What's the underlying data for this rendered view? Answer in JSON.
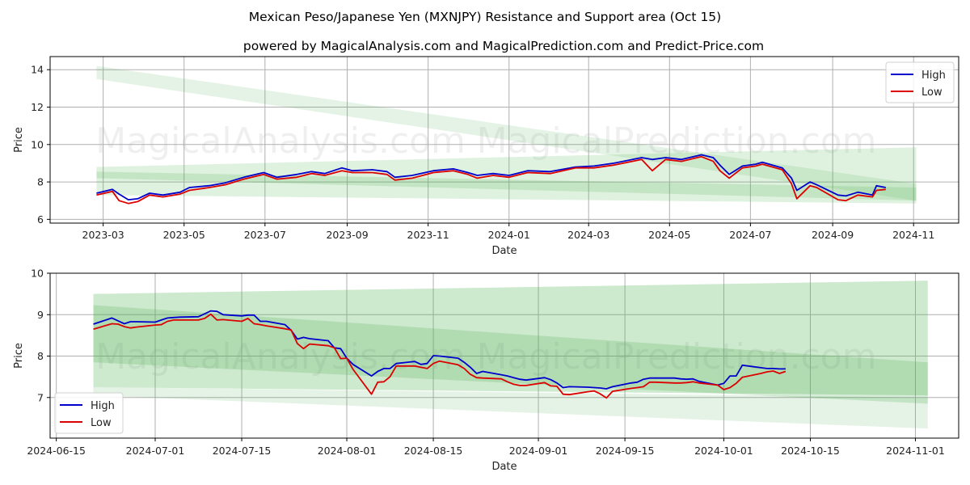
{
  "title": "Mexican Peso/Japanese Yen (MXNJPY) Resistance and Support area (Oct 15)",
  "subtitle": "powered by MagicalAnalysis.com and MagicalPrediction.com and Predict-Price.com",
  "watermarks": [
    "MagicalAnalysis.com",
    "MagicalPrediction.com"
  ],
  "colors": {
    "high": "#0000cc",
    "low": "#dd0000",
    "band": "#4caf50"
  },
  "chart_data": [
    {
      "type": "line",
      "name": "full-history",
      "xlabel": "Date",
      "ylabel": "Price",
      "x_range": [
        "2023-01-20",
        "2024-12-05"
      ],
      "ylim": [
        5.8,
        14.7
      ],
      "grid": true,
      "legend": {
        "position": "top-right",
        "entries": [
          "High",
          "Low"
        ]
      },
      "xticks": [
        "2023-03",
        "2023-05",
        "2023-07",
        "2023-09",
        "2023-11",
        "2024-01",
        "2024-03",
        "2024-05",
        "2024-07",
        "2024-09",
        "2024-11"
      ],
      "yticks": [
        6,
        8,
        10,
        12,
        14
      ],
      "series": [
        {
          "name": "High",
          "x": [
            "2023-02-24",
            "2023-03-08",
            "2023-03-13",
            "2023-03-20",
            "2023-03-27",
            "2023-04-05",
            "2023-04-15",
            "2023-04-28",
            "2023-05-05",
            "2023-05-20",
            "2023-06-01",
            "2023-06-15",
            "2023-06-30",
            "2023-07-10",
            "2023-07-25",
            "2023-08-05",
            "2023-08-15",
            "2023-08-28",
            "2023-09-05",
            "2023-09-20",
            "2023-10-01",
            "2023-10-07",
            "2023-10-20",
            "2023-11-05",
            "2023-11-20",
            "2023-12-01",
            "2023-12-08",
            "2023-12-20",
            "2024-01-01",
            "2024-01-15",
            "2024-02-01",
            "2024-02-20",
            "2024-03-05",
            "2024-03-20",
            "2024-04-10",
            "2024-04-18",
            "2024-04-28",
            "2024-05-10",
            "2024-05-25",
            "2024-06-03",
            "2024-06-08",
            "2024-06-15",
            "2024-06-25",
            "2024-07-05",
            "2024-07-10",
            "2024-07-25",
            "2024-08-01",
            "2024-08-05",
            "2024-08-15",
            "2024-08-20",
            "2024-09-05",
            "2024-09-11",
            "2024-09-20",
            "2024-10-01",
            "2024-10-04",
            "2024-10-11"
          ],
          "values": [
            7.4,
            7.6,
            7.35,
            7.05,
            7.1,
            7.4,
            7.3,
            7.45,
            7.7,
            7.8,
            7.95,
            8.25,
            8.5,
            8.25,
            8.4,
            8.55,
            8.45,
            8.75,
            8.6,
            8.65,
            8.55,
            8.25,
            8.35,
            8.6,
            8.7,
            8.5,
            8.35,
            8.45,
            8.35,
            8.6,
            8.55,
            8.8,
            8.85,
            9.0,
            9.3,
            9.2,
            9.3,
            9.2,
            9.45,
            9.3,
            8.9,
            8.4,
            8.85,
            8.95,
            9.05,
            8.75,
            8.2,
            7.55,
            8.0,
            7.85,
            7.3,
            7.25,
            7.45,
            7.3,
            7.8,
            7.7
          ]
        },
        {
          "name": "Low",
          "x": [
            "2023-02-24",
            "2023-03-08",
            "2023-03-13",
            "2023-03-20",
            "2023-03-27",
            "2023-04-05",
            "2023-04-15",
            "2023-04-28",
            "2023-05-05",
            "2023-05-20",
            "2023-06-01",
            "2023-06-15",
            "2023-06-30",
            "2023-07-10",
            "2023-07-25",
            "2023-08-05",
            "2023-08-15",
            "2023-08-28",
            "2023-09-05",
            "2023-09-20",
            "2023-10-01",
            "2023-10-07",
            "2023-10-20",
            "2023-11-05",
            "2023-11-20",
            "2023-12-01",
            "2023-12-08",
            "2023-12-20",
            "2024-01-01",
            "2024-01-15",
            "2024-02-01",
            "2024-02-20",
            "2024-03-05",
            "2024-03-20",
            "2024-04-10",
            "2024-04-18",
            "2024-04-28",
            "2024-05-10",
            "2024-05-25",
            "2024-06-03",
            "2024-06-08",
            "2024-06-15",
            "2024-06-25",
            "2024-07-05",
            "2024-07-10",
            "2024-07-25",
            "2024-08-01",
            "2024-08-05",
            "2024-08-15",
            "2024-08-20",
            "2024-09-05",
            "2024-09-11",
            "2024-09-20",
            "2024-10-01",
            "2024-10-04",
            "2024-10-11"
          ],
          "values": [
            7.3,
            7.5,
            7.0,
            6.85,
            6.95,
            7.3,
            7.2,
            7.35,
            7.55,
            7.7,
            7.85,
            8.15,
            8.4,
            8.15,
            8.25,
            8.45,
            8.35,
            8.6,
            8.5,
            8.5,
            8.4,
            8.1,
            8.2,
            8.5,
            8.6,
            8.4,
            8.2,
            8.35,
            8.25,
            8.5,
            8.45,
            8.75,
            8.75,
            8.9,
            9.2,
            8.6,
            9.2,
            9.1,
            9.35,
            9.1,
            8.6,
            8.2,
            8.75,
            8.85,
            8.95,
            8.65,
            7.9,
            7.1,
            7.8,
            7.7,
            7.05,
            7.0,
            7.3,
            7.2,
            7.55,
            7.6
          ]
        }
      ],
      "bands": [
        {
          "name": "upper-resistance-band",
          "x": [
            "2023-02-24",
            "2024-11-03"
          ],
          "upper": [
            14.2,
            7.9
          ],
          "lower": [
            13.5,
            7.0
          ],
          "opacity": 0.15
        },
        {
          "name": "support-band-wide",
          "x": [
            "2023-02-24",
            "2024-11-03"
          ],
          "upper": [
            8.8,
            9.85
          ],
          "lower": [
            7.3,
            6.85
          ],
          "opacity": 0.18
        },
        {
          "name": "support-band-inner",
          "x": [
            "2023-02-24",
            "2024-11-03"
          ],
          "upper": [
            8.55,
            7.7
          ],
          "lower": [
            8.2,
            7.0
          ],
          "opacity": 0.18
        }
      ]
    },
    {
      "type": "line",
      "name": "recent-zoom",
      "xlabel": "Date",
      "ylabel": "Price",
      "x_range": [
        "2024-06-14",
        "2024-11-08"
      ],
      "ylim": [
        6.02,
        10.0
      ],
      "grid": true,
      "legend": {
        "position": "lower-left",
        "entries": [
          "High",
          "Low"
        ]
      },
      "xticks": [
        "2024-06-15",
        "2024-07-01",
        "2024-07-15",
        "2024-08-01",
        "2024-08-15",
        "2024-09-01",
        "2024-09-15",
        "2024-10-01",
        "2024-10-15",
        "2024-11-01"
      ],
      "yticks": [
        7,
        8,
        9,
        10
      ],
      "series": [
        {
          "name": "High",
          "x": [
            "2024-06-21",
            "2024-06-24",
            "2024-06-25",
            "2024-06-26",
            "2024-06-27",
            "2024-06-28",
            "2024-07-01",
            "2024-07-02",
            "2024-07-03",
            "2024-07-04",
            "2024-07-05",
            "2024-07-08",
            "2024-07-09",
            "2024-07-10",
            "2024-07-11",
            "2024-07-12",
            "2024-07-15",
            "2024-07-16",
            "2024-07-17",
            "2024-07-18",
            "2024-07-19",
            "2024-07-22",
            "2024-07-23",
            "2024-07-24",
            "2024-07-25",
            "2024-07-26",
            "2024-07-29",
            "2024-07-30",
            "2024-07-31",
            "2024-08-01",
            "2024-08-02",
            "2024-08-05",
            "2024-08-06",
            "2024-08-07",
            "2024-08-08",
            "2024-08-09",
            "2024-08-12",
            "2024-08-13",
            "2024-08-14",
            "2024-08-15",
            "2024-08-16",
            "2024-08-19",
            "2024-08-20",
            "2024-08-21",
            "2024-08-22",
            "2024-08-23",
            "2024-08-26",
            "2024-08-27",
            "2024-08-28",
            "2024-08-29",
            "2024-08-30",
            "2024-09-02",
            "2024-09-03",
            "2024-09-04",
            "2024-09-05",
            "2024-09-06",
            "2024-09-09",
            "2024-09-10",
            "2024-09-11",
            "2024-09-12",
            "2024-09-13",
            "2024-09-16",
            "2024-09-17",
            "2024-09-18",
            "2024-09-19",
            "2024-09-20",
            "2024-09-23",
            "2024-09-24",
            "2024-09-25",
            "2024-09-26",
            "2024-09-27",
            "2024-09-30",
            "2024-10-01",
            "2024-10-02",
            "2024-10-03",
            "2024-10-04",
            "2024-10-07",
            "2024-10-08",
            "2024-10-09",
            "2024-10-10",
            "2024-10-11"
          ],
          "values": [
            8.77,
            8.92,
            8.85,
            8.78,
            8.83,
            8.83,
            8.82,
            8.87,
            8.92,
            8.93,
            8.94,
            8.95,
            9.02,
            9.09,
            9.08,
            9.0,
            8.97,
            8.99,
            8.99,
            8.84,
            8.84,
            8.76,
            8.62,
            8.41,
            8.45,
            8.42,
            8.37,
            8.2,
            8.18,
            7.95,
            7.8,
            7.52,
            7.63,
            7.7,
            7.7,
            7.82,
            7.87,
            7.8,
            7.82,
            8.01,
            8.0,
            7.95,
            7.85,
            7.73,
            7.58,
            7.63,
            7.55,
            7.52,
            7.48,
            7.44,
            7.42,
            7.48,
            7.43,
            7.35,
            7.24,
            7.26,
            7.25,
            7.24,
            7.23,
            7.21,
            7.26,
            7.35,
            7.37,
            7.44,
            7.47,
            7.47,
            7.47,
            7.45,
            7.44,
            7.45,
            7.39,
            7.3,
            7.34,
            7.52,
            7.52,
            7.78,
            7.72,
            7.7,
            7.7,
            7.69,
            7.69
          ]
        },
        {
          "name": "Low",
          "x": [
            "2024-06-21",
            "2024-06-24",
            "2024-06-25",
            "2024-06-26",
            "2024-06-27",
            "2024-06-28",
            "2024-07-01",
            "2024-07-02",
            "2024-07-03",
            "2024-07-04",
            "2024-07-05",
            "2024-07-08",
            "2024-07-09",
            "2024-07-10",
            "2024-07-11",
            "2024-07-12",
            "2024-07-15",
            "2024-07-16",
            "2024-07-17",
            "2024-07-18",
            "2024-07-19",
            "2024-07-22",
            "2024-07-23",
            "2024-07-24",
            "2024-07-25",
            "2024-07-26",
            "2024-07-29",
            "2024-07-30",
            "2024-07-31",
            "2024-08-01",
            "2024-08-02",
            "2024-08-05",
            "2024-08-06",
            "2024-08-07",
            "2024-08-08",
            "2024-08-09",
            "2024-08-12",
            "2024-08-13",
            "2024-08-14",
            "2024-08-15",
            "2024-08-16",
            "2024-08-19",
            "2024-08-20",
            "2024-08-21",
            "2024-08-22",
            "2024-08-23",
            "2024-08-26",
            "2024-08-27",
            "2024-08-28",
            "2024-08-29",
            "2024-08-30",
            "2024-09-02",
            "2024-09-03",
            "2024-09-04",
            "2024-09-05",
            "2024-09-06",
            "2024-09-09",
            "2024-09-10",
            "2024-09-11",
            "2024-09-12",
            "2024-09-13",
            "2024-09-16",
            "2024-09-17",
            "2024-09-18",
            "2024-09-19",
            "2024-09-20",
            "2024-09-23",
            "2024-09-24",
            "2024-09-25",
            "2024-09-26",
            "2024-09-27",
            "2024-09-30",
            "2024-10-01",
            "2024-10-02",
            "2024-10-03",
            "2024-10-04",
            "2024-10-07",
            "2024-10-08",
            "2024-10-09",
            "2024-10-10",
            "2024-10-11"
          ],
          "values": [
            8.65,
            8.78,
            8.77,
            8.71,
            8.68,
            8.7,
            8.75,
            8.76,
            8.84,
            8.87,
            8.87,
            8.87,
            8.91,
            9.01,
            8.87,
            8.88,
            8.84,
            8.91,
            8.78,
            8.76,
            8.73,
            8.66,
            8.63,
            8.3,
            8.18,
            8.29,
            8.25,
            8.2,
            7.94,
            7.95,
            7.68,
            7.08,
            7.37,
            7.38,
            7.5,
            7.76,
            7.76,
            7.73,
            7.7,
            7.82,
            7.88,
            7.79,
            7.7,
            7.56,
            7.48,
            7.47,
            7.45,
            7.38,
            7.32,
            7.29,
            7.29,
            7.36,
            7.28,
            7.27,
            7.08,
            7.07,
            7.14,
            7.16,
            7.09,
            6.99,
            7.15,
            7.22,
            7.24,
            7.26,
            7.37,
            7.37,
            7.35,
            7.35,
            7.36,
            7.38,
            7.35,
            7.3,
            7.19,
            7.24,
            7.34,
            7.49,
            7.58,
            7.62,
            7.64,
            7.58,
            7.63
          ]
        }
      ],
      "bands": [
        {
          "name": "outer-band-top",
          "x": [
            "2024-06-21",
            "2024-11-03"
          ],
          "upper": [
            9.5,
            9.82
          ],
          "lower": [
            7.25,
            7.05
          ],
          "opacity": 0.28
        },
        {
          "name": "inner-band-dark",
          "x": [
            "2024-06-21",
            "2024-11-03"
          ],
          "upper": [
            9.23,
            7.85
          ],
          "lower": [
            7.85,
            6.85
          ],
          "opacity": 0.22
        },
        {
          "name": "outer-band-bottom",
          "x": [
            "2024-06-21",
            "2024-11-03"
          ],
          "upper": [
            7.25,
            7.0
          ],
          "lower": [
            7.05,
            6.25
          ],
          "opacity": 0.15
        }
      ]
    }
  ]
}
